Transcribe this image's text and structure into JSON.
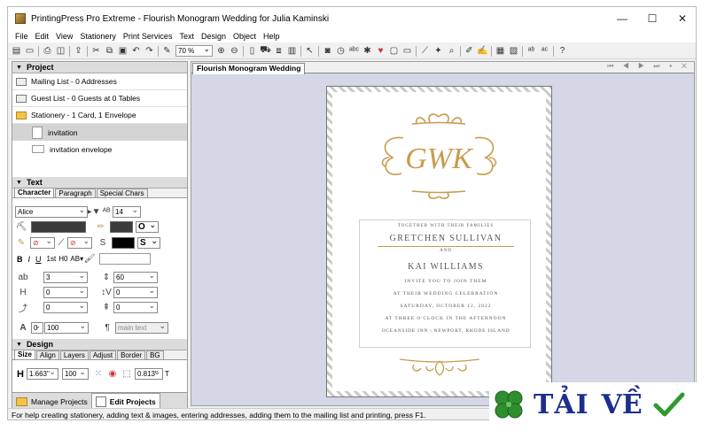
{
  "window": {
    "title": "PrintingPress Pro Extreme - Flourish Monogram Wedding for Julia Kaminski"
  },
  "menu": [
    "File",
    "Edit",
    "View",
    "Stationery",
    "Print Services",
    "Text",
    "Design",
    "Object",
    "Help"
  ],
  "toolbar": {
    "zoom": "70 %"
  },
  "project": {
    "header": "Project",
    "mailing": "Mailing List - 0 Addresses",
    "guest": "Guest List - 0 Guests at 0 Tables",
    "stationery": "Stationery - 1 Card, 1 Envelope",
    "items": [
      "invitation",
      "invitation envelope"
    ]
  },
  "text_panel": {
    "header": "Text",
    "tabs": [
      "Character",
      "Paragraph",
      "Special Chars"
    ],
    "font": "Alice",
    "size": "14",
    "outline_style": "O",
    "shadow_style": "S",
    "letter_spacing": "3",
    "line_spacing": "60",
    "h_offset": "0",
    "v_offset": "0",
    "rotation": "0",
    "baseline": "0",
    "angle": "0",
    "scale": "100",
    "style_sheet": "main text",
    "superscript": "1st",
    "h0_label": "H0",
    "caps_label": "AB"
  },
  "design_panel": {
    "header": "Design",
    "tabs": [
      "Size",
      "Align",
      "Layers",
      "Adjust",
      "Border",
      "BG"
    ],
    "height_label": "H",
    "height": "1.663\"",
    "height_pct": "100",
    "top": "0.813\"",
    "top_label": "T"
  },
  "bottom_tabs": [
    "Manage Projects",
    "Edit Projects"
  ],
  "document": {
    "tab": "Flourish Monogram Wedding",
    "monogram": "GWK",
    "lines": {
      "together": "TOGETHER WITH THEIR FAMILIES",
      "name1": "GRETCHEN SULLIVAN",
      "and": "AND",
      "name2": "KAI WILLIAMS",
      "invite": "INVITE YOU TO JOIN THEM",
      "at": "AT THEIR WEDDING CELEBRATION",
      "date": "SATURDAY, OCTOBER 12, 2022",
      "time": "AT THREE O'CLOCK IN THE AFTERNOON",
      "place": "OCEANSIDE INN | NEWPORT, RHODE ISLAND"
    }
  },
  "status": "For help creating stationery, adding text & images, entering addresses, adding them to the mailing list and printing, press F1.",
  "watermark": {
    "part1": "TẢI",
    "part2": "VỀ"
  },
  "colors": {
    "gold": "#c89b4e",
    "canvas": "#d5d6e6",
    "brand_blue": "#1c2f8f"
  }
}
